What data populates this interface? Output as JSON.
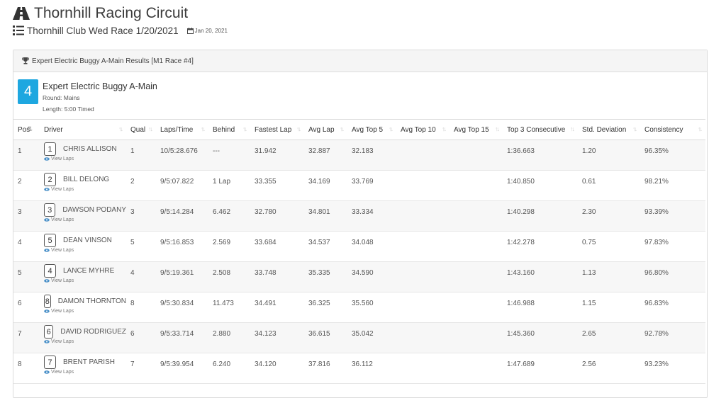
{
  "site": {
    "title": "Thornhill Racing Circuit"
  },
  "event": {
    "name": "Thornhill Club Wed Race 1/20/2021",
    "date": "Jan 20, 2021"
  },
  "panel": {
    "heading": "Expert Electric Buggy A-Main Results [M1 Race #4]"
  },
  "race": {
    "number": "4",
    "title": "Expert Electric Buggy A-Main",
    "round": "Round: Mains",
    "length": "Length: 5:00 Timed"
  },
  "table": {
    "view_laps_label": "View Laps",
    "columns": [
      "Pos",
      "Driver",
      "Qual",
      "Laps/Time",
      "Behind",
      "Fastest Lap",
      "Avg Lap",
      "Avg Top 5",
      "Avg Top 10",
      "Avg Top 15",
      "Top 3 Consecutive",
      "Std. Deviation",
      "Consistency"
    ],
    "rows": [
      {
        "pos": "1",
        "car": "1",
        "driver": "CHRIS ALLISON",
        "qual": "1",
        "laps_time": "10/5:28.676",
        "behind": "---",
        "fastest": "31.942",
        "avg_lap": "32.887",
        "avg_top5": "32.183",
        "avg_top10": "",
        "avg_top15": "",
        "top3": "1:36.663",
        "stddev": "1.20",
        "consistency": "96.35%"
      },
      {
        "pos": "2",
        "car": "2",
        "driver": "BILL DELONG",
        "qual": "2",
        "laps_time": "9/5:07.822",
        "behind": "1 Lap",
        "fastest": "33.355",
        "avg_lap": "34.169",
        "avg_top5": "33.769",
        "avg_top10": "",
        "avg_top15": "",
        "top3": "1:40.850",
        "stddev": "0.61",
        "consistency": "98.21%"
      },
      {
        "pos": "3",
        "car": "3",
        "driver": "DAWSON PODANY",
        "qual": "3",
        "laps_time": "9/5:14.284",
        "behind": "6.462",
        "fastest": "32.780",
        "avg_lap": "34.801",
        "avg_top5": "33.334",
        "avg_top10": "",
        "avg_top15": "",
        "top3": "1:40.298",
        "stddev": "2.30",
        "consistency": "93.39%"
      },
      {
        "pos": "4",
        "car": "5",
        "driver": "DEAN VINSON",
        "qual": "5",
        "laps_time": "9/5:16.853",
        "behind": "2.569",
        "fastest": "33.684",
        "avg_lap": "34.537",
        "avg_top5": "34.048",
        "avg_top10": "",
        "avg_top15": "",
        "top3": "1:42.278",
        "stddev": "0.75",
        "consistency": "97.83%"
      },
      {
        "pos": "5",
        "car": "4",
        "driver": "LANCE MYHRE",
        "qual": "4",
        "laps_time": "9/5:19.361",
        "behind": "2.508",
        "fastest": "33.748",
        "avg_lap": "35.335",
        "avg_top5": "34.590",
        "avg_top10": "",
        "avg_top15": "",
        "top3": "1:43.160",
        "stddev": "1.13",
        "consistency": "96.80%"
      },
      {
        "pos": "6",
        "car": "8",
        "driver": "DAMON THORNTON",
        "qual": "8",
        "laps_time": "9/5:30.834",
        "behind": "11.473",
        "fastest": "34.491",
        "avg_lap": "36.325",
        "avg_top5": "35.560",
        "avg_top10": "",
        "avg_top15": "",
        "top3": "1:46.988",
        "stddev": "1.15",
        "consistency": "96.83%"
      },
      {
        "pos": "7",
        "car": "6",
        "driver": "DAVID RODRIGUEZ",
        "qual": "6",
        "laps_time": "9/5:33.714",
        "behind": "2.880",
        "fastest": "34.123",
        "avg_lap": "36.615",
        "avg_top5": "35.042",
        "avg_top10": "",
        "avg_top15": "",
        "top3": "1:45.360",
        "stddev": "2.65",
        "consistency": "92.78%"
      },
      {
        "pos": "8",
        "car": "7",
        "driver": "BRENT PARISH",
        "qual": "7",
        "laps_time": "9/5:39.954",
        "behind": "6.240",
        "fastest": "34.120",
        "avg_lap": "37.816",
        "avg_top5": "36.112",
        "avg_top10": "",
        "avg_top15": "",
        "top3": "1:47.689",
        "stddev": "2.56",
        "consistency": "93.23%"
      }
    ]
  },
  "colors": {
    "race_badge": "#1ea7e0",
    "header_bg": "#f5f5f5",
    "row_stripe": "#f7f7f7"
  },
  "icons": [
    "road-icon",
    "list-icon",
    "calendar-icon",
    "trophy-icon",
    "eye-icon",
    "sort-icon"
  ]
}
